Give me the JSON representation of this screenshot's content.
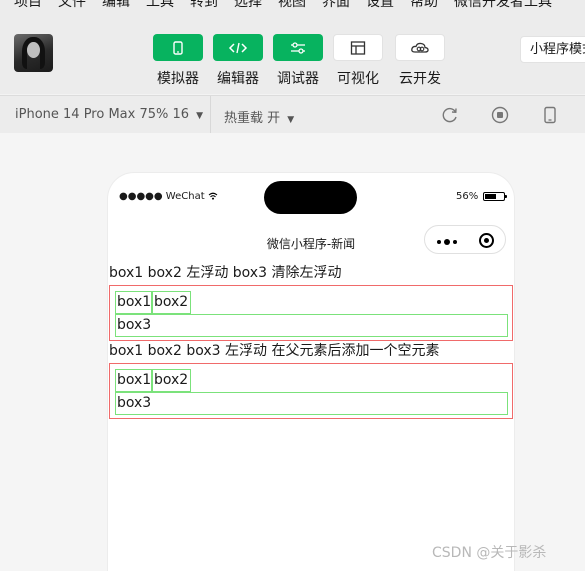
{
  "menu": [
    "项目",
    "文件",
    "编辑",
    "工具",
    "转到",
    "选择",
    "视图",
    "界面",
    "设置",
    "帮助",
    "微信开发者工具"
  ],
  "toolbar": {
    "tools": [
      {
        "label": "模拟器",
        "icon": "phone-icon",
        "style": "green"
      },
      {
        "label": "编辑器",
        "icon": "code-icon",
        "style": "green"
      },
      {
        "label": "调试器",
        "icon": "sliders-icon",
        "style": "green"
      },
      {
        "label": "可视化",
        "icon": "layout-icon",
        "style": "white"
      },
      {
        "label": "云开发",
        "icon": "cloud-icon",
        "style": "white"
      }
    ],
    "mode": "小程序模式"
  },
  "device_bar": {
    "device": "iPhone 14 Pro Max 75% 16",
    "hot_reload": "热重载 开"
  },
  "phone": {
    "carrier": "●●●●● WeChat",
    "battery": "56%",
    "nav_title": "微信小程序-新闻"
  },
  "content": {
    "heading1": "box1 box2 左浮动 box3 清除左浮动",
    "heading2": "box1 box2 box3 左浮动 在父元素后添加一个空元素",
    "box1": "box1",
    "box2": "box2",
    "box3": "box3"
  },
  "watermark": "CSDN @关于影杀",
  "colors": {
    "accent_green": "#07b35f",
    "outer_border": "#f06a6a",
    "inner_border": "#7be27b"
  }
}
